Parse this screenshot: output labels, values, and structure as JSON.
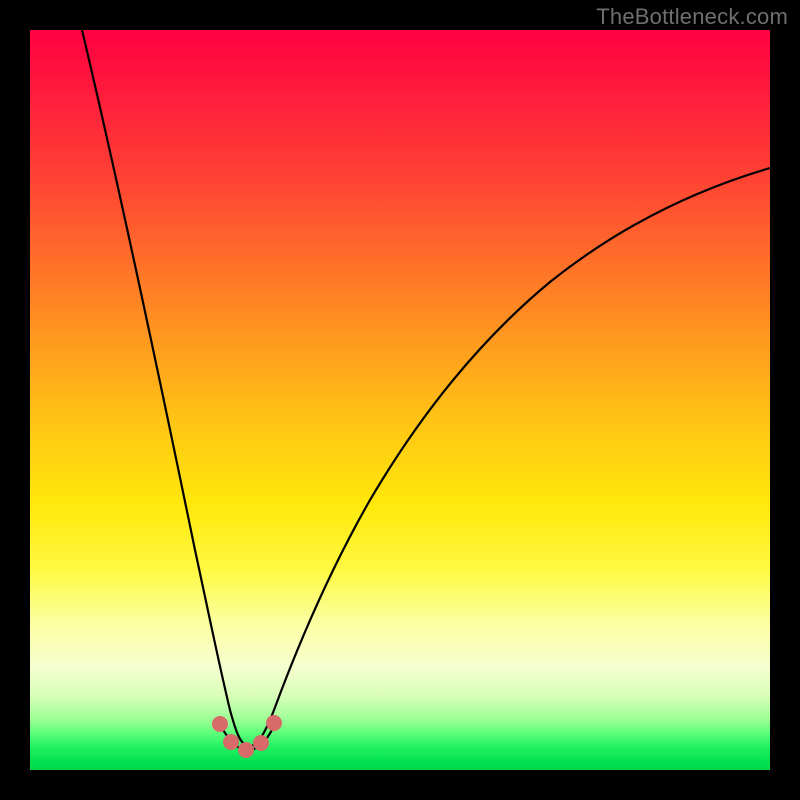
{
  "watermark": "TheBottleneck.com",
  "chart_data": {
    "type": "line",
    "title": "",
    "xlabel": "",
    "ylabel": "",
    "xlim": [
      0,
      100
    ],
    "ylim": [
      0,
      100
    ],
    "grid": false,
    "curve_note": "V-shaped bottleneck curve reaching minimum near x≈28 with y≈3; left branch starts near (7,100) falling steeply; right branch rises to about (100,70).",
    "series": [
      {
        "name": "bottleneck-curve",
        "x": [
          7,
          10,
          13,
          16,
          19,
          22,
          24,
          26,
          28,
          30,
          32,
          35,
          40,
          46,
          54,
          64,
          76,
          88,
          100
        ],
        "y": [
          100,
          88,
          76,
          63,
          50,
          36,
          22,
          10,
          3,
          5,
          12,
          22,
          34,
          44,
          53,
          60,
          65,
          68,
          70
        ]
      }
    ],
    "markers": {
      "note": "Highlighted low-bottleneck region near the curve minimum",
      "points": [
        {
          "x": 25.5,
          "y": 8
        },
        {
          "x": 26.5,
          "y": 4.5
        },
        {
          "x": 28.0,
          "y": 3.0
        },
        {
          "x": 29.5,
          "y": 4.0
        },
        {
          "x": 31.0,
          "y": 8.5
        }
      ]
    }
  },
  "colors": {
    "marker": "#d86a6a",
    "curve": "#000000",
    "background_top": "#ff0040",
    "background_bottom": "#00d848"
  }
}
